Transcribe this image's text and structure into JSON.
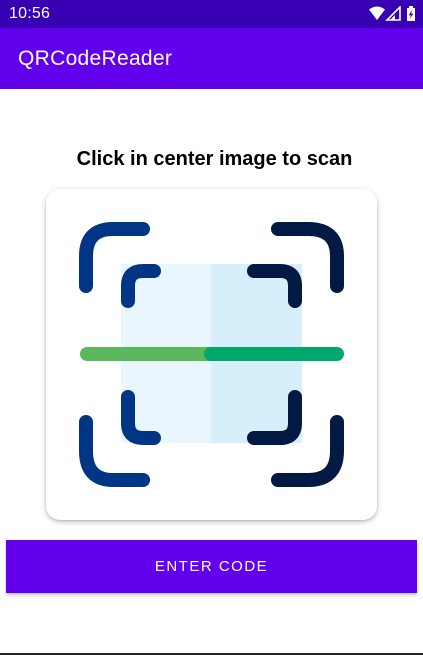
{
  "status_bar": {
    "time": "10:56",
    "icons": [
      "wifi-icon",
      "signal-icon",
      "battery-icon"
    ]
  },
  "app_bar": {
    "title": "QRCodeReader"
  },
  "main": {
    "instruction": "Click in center image to scan",
    "scan_icon": "qr-scan-icon",
    "enter_code_label": "ENTER CODE"
  },
  "colors": {
    "status_bar": "#3700b3",
    "app_bar": "#6200ee",
    "button": "#6200ee",
    "frame_dark_blue": "#003586",
    "frame_navy": "#021a43",
    "scan_line_green": "#5cb85c",
    "scan_line_teal": "#00a86b"
  }
}
